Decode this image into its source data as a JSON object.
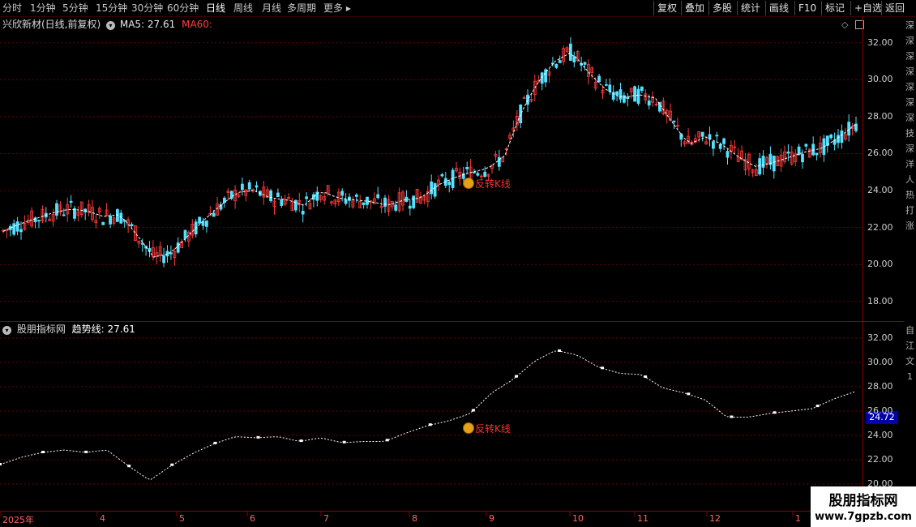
{
  "toolbar": {
    "periods": [
      "分时",
      "1分钟",
      "5分钟",
      "15分钟",
      "30分钟",
      "60分钟",
      "日线",
      "周线",
      "月线",
      "多周期",
      "更多"
    ],
    "active_period": "日线",
    "tools": [
      "复权",
      "叠加",
      "多股",
      "统计",
      "画线",
      "F10",
      "标记",
      "+自选",
      "返回"
    ]
  },
  "main_panel": {
    "stock_name": "兴欣新材(日线,前复权)",
    "ma5_label": "MA5: 27.61",
    "ma60_label": "MA60:",
    "y_ticks": [
      "32.00",
      "30.00",
      "28.00",
      "26.00",
      "24.00",
      "22.00",
      "20.00",
      "18.00"
    ],
    "signal_text": "反转K线"
  },
  "indicator_panel": {
    "name": "股朋指标网",
    "trend_label": "趋势线:",
    "trend_value": "27.61",
    "y_ticks": [
      "32.00",
      "30.00",
      "28.00",
      "26.00",
      "24.00",
      "22.00",
      "20.00"
    ],
    "current_value": "24.72",
    "signal_text": "反转K线"
  },
  "time_axis": [
    "2025年",
    "4",
    "5",
    "6",
    "7",
    "8",
    "9",
    "10",
    "11",
    "12",
    "1"
  ],
  "side_strip": {
    "upper": "深深深深深深深技深洋人热打涨",
    "lower": "自江文1"
  },
  "watermark": {
    "title": "股朋指标网",
    "url": "www.7gpzb.com"
  },
  "colors": {
    "up": "#ff3b3b",
    "down": "#54e1ff",
    "ma": "#ffffff",
    "grid": "#6b0000",
    "active_tab": "#ffffff"
  },
  "chart_data": {
    "type": "line",
    "series": [
      {
        "name": "MA5",
        "values": [
          21.8,
          22.2,
          22.5,
          22.8,
          23.0,
          22.9,
          22.6,
          22.7,
          21.6,
          20.4,
          20.6,
          21.5,
          22.4,
          23.2,
          23.9,
          24.0,
          23.6,
          23.5,
          23.2,
          24.0,
          23.6,
          23.5,
          23.4,
          23.2,
          23.5,
          23.6,
          24.3,
          24.7,
          25.0,
          25.2,
          25.9,
          28.3,
          29.9,
          31.0,
          31.5,
          30.4,
          29.5,
          29.0,
          29.2,
          29.0,
          27.7,
          26.5,
          26.9,
          26.5,
          25.8,
          25.3,
          25.5,
          25.8,
          26.1,
          26.3,
          26.9,
          27.6
        ]
      },
      {
        "name": "趋势线",
        "values": [
          21.6,
          22.2,
          22.6,
          22.8,
          22.6,
          22.8,
          21.5,
          20.3,
          21.5,
          22.5,
          23.3,
          23.9,
          23.8,
          23.9,
          23.5,
          23.8,
          23.4,
          23.5,
          23.5,
          24.2,
          24.8,
          25.2,
          25.8,
          27.5,
          28.6,
          30.1,
          31.0,
          30.6,
          29.6,
          29.1,
          29.0,
          27.9,
          27.5,
          26.9,
          25.5,
          25.5,
          25.8,
          26.0,
          26.2,
          27.0,
          27.6
        ]
      }
    ],
    "ylim_main": [
      17.2,
      33.0
    ],
    "ylim_indicator": [
      19.8,
      33.0
    ],
    "y_ticks_main": [
      18,
      20,
      22,
      24,
      26,
      28,
      30,
      32
    ],
    "y_ticks_indicator": [
      20,
      22,
      24,
      26,
      28,
      30,
      32
    ]
  }
}
